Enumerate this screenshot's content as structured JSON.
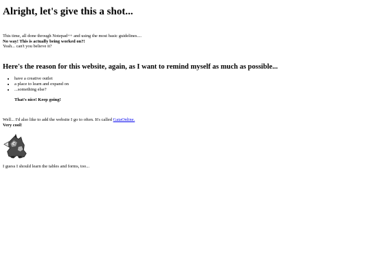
{
  "heading_main": "Alright, let's give this a shot...",
  "intro": {
    "line1": "This time, all done through Notepad++ and using the most basic guidelines....",
    "line2": "No way! This is actually being worked on?!",
    "line3": "Yeah... can't you believe it?"
  },
  "heading_reason": "Here's the reason for this website, again, as I want to remind myself as much as possible...",
  "reasons": [
    "have a creative outlet",
    "a place to learn and expand on",
    "...something else?"
  ],
  "encouragement": "That's nice! Keep going!",
  "website": {
    "text_before": "Well... I'd also like to add the website I go to often. It's called ",
    "link_text": "GaiaOnline.",
    "reaction": "Very cool!"
  },
  "mascot_icon": "gaia-mascot-icon",
  "closing": "I guess I should learn the tables and forms, too...",
  "colors": {
    "link": "#0000ee",
    "text": "#000000",
    "background": "#ffffff"
  }
}
